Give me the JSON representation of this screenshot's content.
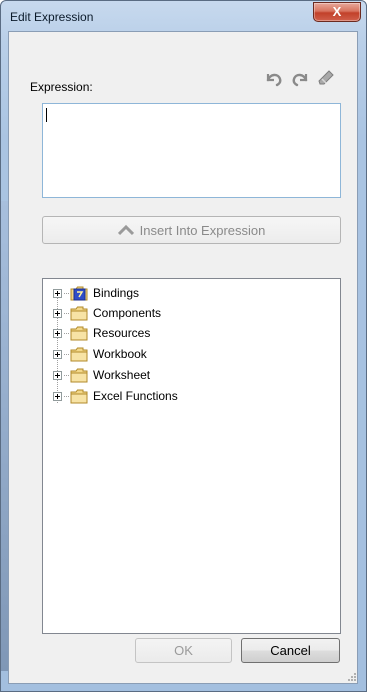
{
  "window": {
    "title": "Edit Expression",
    "close_glyph": "X"
  },
  "expression": {
    "label": "Expression:",
    "value": ""
  },
  "toolbar": {
    "icons": [
      "undo-icon",
      "redo-icon",
      "eraser-icon"
    ]
  },
  "insert_button": {
    "label": "Insert Into Expression",
    "enabled": false,
    "icon": "chevron-up-icon"
  },
  "tree": {
    "items": [
      {
        "label": "Bindings",
        "icon": "bindings-folder-icon"
      },
      {
        "label": "Components",
        "icon": "folder-icon"
      },
      {
        "label": "Resources",
        "icon": "folder-icon"
      },
      {
        "label": "Workbook",
        "icon": "folder-icon"
      },
      {
        "label": "Worksheet",
        "icon": "folder-icon"
      },
      {
        "label": "Excel Functions",
        "icon": "folder-icon"
      }
    ]
  },
  "buttons": {
    "ok_label": "OK",
    "ok_enabled": false,
    "cancel_label": "Cancel"
  },
  "colors": {
    "titlebar": "#b9cfe8",
    "close": "#c2412a",
    "folder": "#f3d88a",
    "bindings_badge": "#2e4cc8"
  }
}
